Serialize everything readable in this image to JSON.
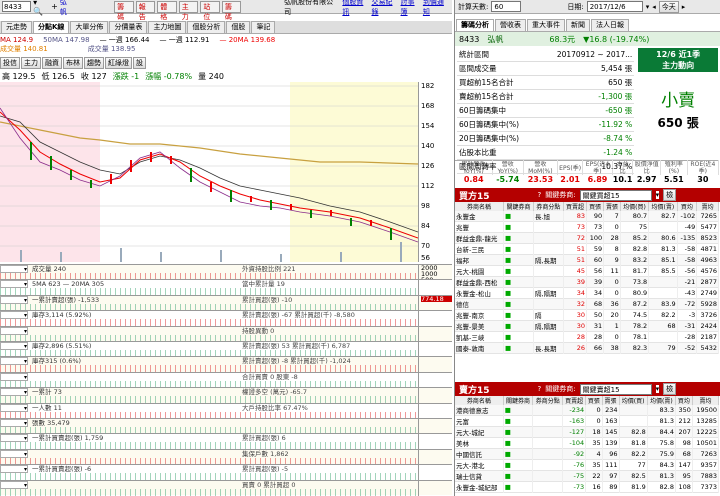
{
  "toolbar": {
    "symbol": "8433",
    "symbol_name": "弘帆",
    "tabs": [
      "元走勢",
      "分點K線",
      "大單分佈",
      "分價量表",
      "主力地圖",
      "個股分析",
      "個股",
      "筆記"
    ],
    "red_buttons": [
      "籌碼",
      "報告",
      "體格",
      "主力",
      "站位",
      "籌碼"
    ],
    "company_title": "弘帆股份有限公司",
    "links": [
      "個股資訊",
      "交易紀錄",
      "討事簿",
      "到價通知"
    ]
  },
  "legend": {
    "ma_left": "MA 124.9",
    "ma_left2": "成交量 140.81",
    "ma50": "50MA 147.98",
    "ma_vol": "成交量 138.95",
    "line1": "一週 166.44",
    "line2": "一週 112.91",
    "ma20": "20MA 139.68"
  },
  "period_buttons": [
    "投信",
    "主力",
    "融資",
    "布林",
    "趨勢",
    "紅綠燈",
    "設"
  ],
  "price_info": {
    "high": "高 129.5",
    "low": "低 126.5",
    "close": "收 127",
    "change": "漲跌 -1",
    "pct": "漲幅 -0.78%",
    "vol": "量 240"
  },
  "y_axis": [
    "182",
    "168",
    "154",
    "140",
    "126",
    "112",
    "98",
    "84",
    "70",
    "56"
  ],
  "indicators": [
    {
      "left": "成交量 240",
      "right": "外資持股比例 221",
      "axis": [
        "2000",
        "1000",
        "500"
      ]
    },
    {
      "left": "5MA 623 — 20MA 305",
      "right": "當中累計量 19",
      "axis": []
    },
    {
      "left": "一累計賣超(張) -1,533",
      "right": "累計買超(張) -10",
      "axis": [
        "774.18"
      ]
    },
    {
      "left": "庫存3,114 (5.92%)",
      "right": "累計賣超(張) -67  累計買超(千) -8,580",
      "axis": []
    },
    {
      "left": "",
      "right": "持股異動 0",
      "axis": []
    },
    {
      "left": "庫存2,896 (5.51%)",
      "right": "累計賣超(張) 53  累計買超(千) 6,787",
      "axis": []
    },
    {
      "left": "庫存315 (0.6%)",
      "right": "累計賣超(張) -8  累計買超(千) -1,024",
      "axis": []
    },
    {
      "left": "",
      "right": "合計買賣 0  股東 -8",
      "axis": []
    },
    {
      "left": "一累計 73",
      "right": "權證多空 (萬元) -65.7",
      "axis": []
    },
    {
      "left": "一人數 11",
      "right": "大戶持股比率 67.47%",
      "axis": []
    },
    {
      "left": "張數 35,479",
      "right": "",
      "axis": []
    },
    {
      "left": "一累計買賣超(張) 1,759",
      "right": "累計買超(張) 6",
      "axis": []
    },
    {
      "left": "",
      "right": "集保戶數 1,862",
      "axis": []
    },
    {
      "left": "一累計買賣超(張) -6",
      "right": "累計買超(張) -5",
      "axis": []
    },
    {
      "left": "",
      "right": "買賣 0  累計買超 0",
      "axis": []
    }
  ],
  "right": {
    "days_label": "計算天數:",
    "days_value": "60",
    "date_label": "日期:",
    "date_value": "2017/12/6",
    "today_btn": "今天",
    "tabs": [
      "籌碼分析",
      "營收表",
      "重大事件",
      "新聞",
      "法人日報"
    ],
    "stock_code": "8433",
    "stock_name": "弘帆",
    "price": "68.3元",
    "change": "▼16.8 (-19.74%)",
    "stats": [
      {
        "label": "統計區間",
        "value": "20170912 ~ 2017..."
      },
      {
        "label": "區間成交量",
        "value": "5,454 張"
      },
      {
        "label": "買超前15名合計",
        "value": "650 張"
      },
      {
        "label": "賣超前15名合計",
        "value": "-1,300 張"
      },
      {
        "label": "60日籌碼集中",
        "value": "-650 張"
      },
      {
        "label": "60日籌碼集中(%)",
        "value": "-11.92 %"
      },
      {
        "label": "20日籌碼集中(%)",
        "value": "-8.74 %"
      },
      {
        "label": "佔股本比重",
        "value": "-1.24 %"
      },
      {
        "label": "區間周轉率",
        "value": "10.37 %"
      }
    ],
    "box_title": "12/6 近1季",
    "box_sub": "主力動向",
    "box_main": "小賣",
    "box_val": "650 張",
    "fin_headers": [
      "累計營收YoY(%)",
      "營收YoY(%)",
      "營收MoM(%)",
      "EPS(季)",
      "EPS(近4季)",
      "本益比",
      "股價淨值比",
      "殖利率(%)",
      "ROE(近4季)"
    ],
    "fin_values": [
      "0.84",
      "-5.74",
      "23.53",
      "2.01",
      "6.89",
      "10.1",
      "2.97",
      "5.51",
      "30"
    ],
    "fin_colors": [
      "#e00000",
      "#008000",
      "#e00000",
      "#e00000",
      "#e00000",
      "#000000",
      "#000000",
      "#000000",
      "#000000"
    ],
    "buy_title": "買方15",
    "buy_opt_label": "關鍵券商:",
    "buy_opt_value": "關鍵買超15",
    "buy_btn": "檢",
    "buy_cols": [
      "券商名稱",
      "關鍵券商",
      "券商分點",
      "買賣超",
      "買張",
      "賣張",
      "均價(買)",
      "均價(賣)",
      "買均",
      "賣均"
    ],
    "buy_rows": [
      [
        "永豐金",
        "",
        "長.旭",
        "83",
        "90",
        "7",
        "80.7",
        "82.7",
        "-102",
        "7265"
      ],
      [
        "兆豐",
        "",
        "",
        "73",
        "73",
        "0",
        "75",
        "",
        "-49",
        "5477"
      ],
      [
        "群益金鼎-龍光",
        "",
        "",
        "72",
        "100",
        "28",
        "85.2",
        "80.6",
        "-135",
        "8523"
      ],
      [
        "台新-三民",
        "",
        "",
        "51",
        "59",
        "8",
        "82.8",
        "81.3",
        "-58",
        "4871"
      ],
      [
        "福邦",
        "",
        "隔,長期",
        "51",
        "60",
        "9",
        "83.2",
        "85.1",
        "-58",
        "4963"
      ],
      [
        "元大-桃園",
        "",
        "",
        "45",
        "56",
        "11",
        "81.7",
        "85.5",
        "-56",
        "4576"
      ],
      [
        "群益金鼎-西松",
        "",
        "",
        "39",
        "39",
        "0",
        "73.8",
        "",
        "-21",
        "2877"
      ],
      [
        "永豐金-松山",
        "",
        "隔,隔期",
        "34",
        "34",
        "0",
        "80.9",
        "",
        "-43",
        "2749"
      ],
      [
        "德信",
        "",
        "",
        "32",
        "68",
        "36",
        "87.2",
        "83.9",
        "-72",
        "5928"
      ],
      [
        "兆豐-南京",
        "",
        "隔",
        "30",
        "50",
        "20",
        "74.5",
        "82.2",
        "-3",
        "3726"
      ],
      [
        "兆豐-景美",
        "",
        "隔,隔期",
        "30",
        "31",
        "1",
        "78.2",
        "68",
        "-31",
        "2424"
      ],
      [
        "凱基-三峽",
        "",
        "",
        "28",
        "28",
        "0",
        "78.1",
        "",
        "-28",
        "2187"
      ],
      [
        "國泰-敦南",
        "",
        "長.長期",
        "26",
        "66",
        "38",
        "82.3",
        "79",
        "-52",
        "5432"
      ]
    ],
    "sell_title": "賣方15",
    "sell_opt_label": "關鍵券商:",
    "sell_opt_value": "關鍵賣超15",
    "sell_btn": "檢",
    "sell_cols": [
      "券商名稱",
      "關鍵券商",
      "券商分點",
      "買賣超",
      "買張",
      "賣張",
      "均價(買)",
      "均價(賣)",
      "買均",
      "賣均"
    ],
    "sell_rows": [
      [
        "港商德意志",
        "",
        "",
        "-234",
        "0",
        "234",
        "",
        "83.3",
        "350",
        "19500"
      ],
      [
        "元富",
        "",
        "",
        "-163",
        "0",
        "163",
        "",
        "81.3",
        "212",
        "13285"
      ],
      [
        "元大-城紀",
        "",
        "",
        "-127",
        "18",
        "145",
        "82.8",
        "84.4",
        "207",
        "12225"
      ],
      [
        "美林",
        "",
        "",
        "-104",
        "35",
        "139",
        "81.8",
        "75.8",
        "98",
        "10501"
      ],
      [
        "中國信託",
        "",
        "",
        "-92",
        "4",
        "96",
        "82.2",
        "75.9",
        "68",
        "7263"
      ],
      [
        "元大-港北",
        "",
        "",
        "-76",
        "35",
        "111",
        "77",
        "84.3",
        "147",
        "9357"
      ],
      [
        "瑞士信貸",
        "",
        "",
        "-75",
        "22",
        "97",
        "82.5",
        "81.3",
        "95",
        "7883"
      ],
      [
        "永豐金-城紀部",
        "",
        "",
        "-73",
        "16",
        "89",
        "81.9",
        "82.8",
        "108",
        "7373"
      ]
    ]
  }
}
